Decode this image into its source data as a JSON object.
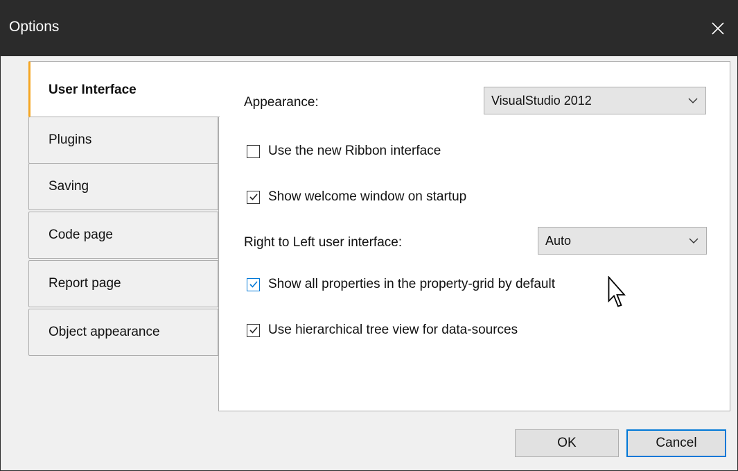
{
  "window": {
    "title": "Options"
  },
  "tabs": [
    {
      "label": "User Interface",
      "active": true
    },
    {
      "label": "Plugins"
    },
    {
      "label": "Saving"
    },
    {
      "label": "Code page"
    },
    {
      "label": "Report page"
    },
    {
      "label": "Object appearance"
    }
  ],
  "panel": {
    "appearance_label": "Appearance:",
    "appearance_value": "VisualStudio 2012",
    "ribbon_label": "Use the new Ribbon interface",
    "ribbon_checked": false,
    "welcome_label": "Show welcome window on startup",
    "welcome_checked": true,
    "rtl_label": "Right to Left user interface:",
    "rtl_value": "Auto",
    "props_label": "Show all properties in the property-grid by default",
    "props_checked": true,
    "tree_label": "Use hierarchical tree view for data-sources",
    "tree_checked": true
  },
  "buttons": {
    "ok": "OK",
    "cancel": "Cancel"
  },
  "colors": {
    "titlebar": "#2b2b2b",
    "accent": "#f5a623",
    "focus": "#0078d7"
  }
}
